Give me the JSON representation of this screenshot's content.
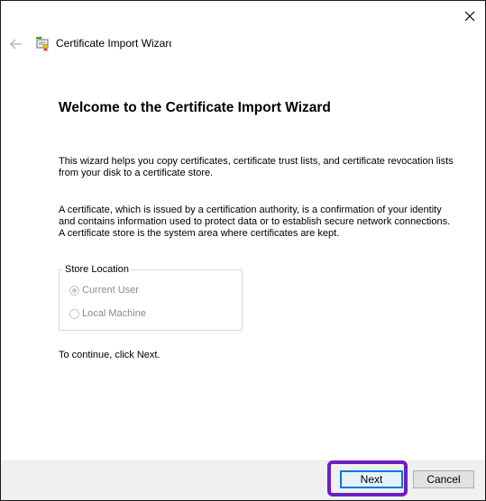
{
  "window": {
    "title": "Certificate Import Wizard"
  },
  "main": {
    "heading": "Welcome to the Certificate Import Wizard",
    "paragraph1": "This wizard helps you copy certificates, certificate trust lists, and certificate revocation lists from your disk to a certificate store.",
    "paragraph2": "A certificate, which is issued by a certification authority, is a confirmation of your identity and contains information used to protect data or to establish secure network connections. A certificate store is the system area where certificates are kept.",
    "store_location": {
      "legend": "Store Location",
      "options": [
        {
          "label": "Current User",
          "checked": true,
          "enabled": false
        },
        {
          "label": "Local Machine",
          "checked": false,
          "enabled": false
        }
      ]
    },
    "continue_text": "To continue, click Next."
  },
  "footer": {
    "next_label": "Next",
    "cancel_label": "Cancel"
  },
  "colors": {
    "highlight": "#6a1fc4",
    "default_button_border": "#0078d7"
  },
  "icons": {
    "close": "close-icon",
    "back": "back-arrow-icon",
    "app": "certificate-icon"
  }
}
